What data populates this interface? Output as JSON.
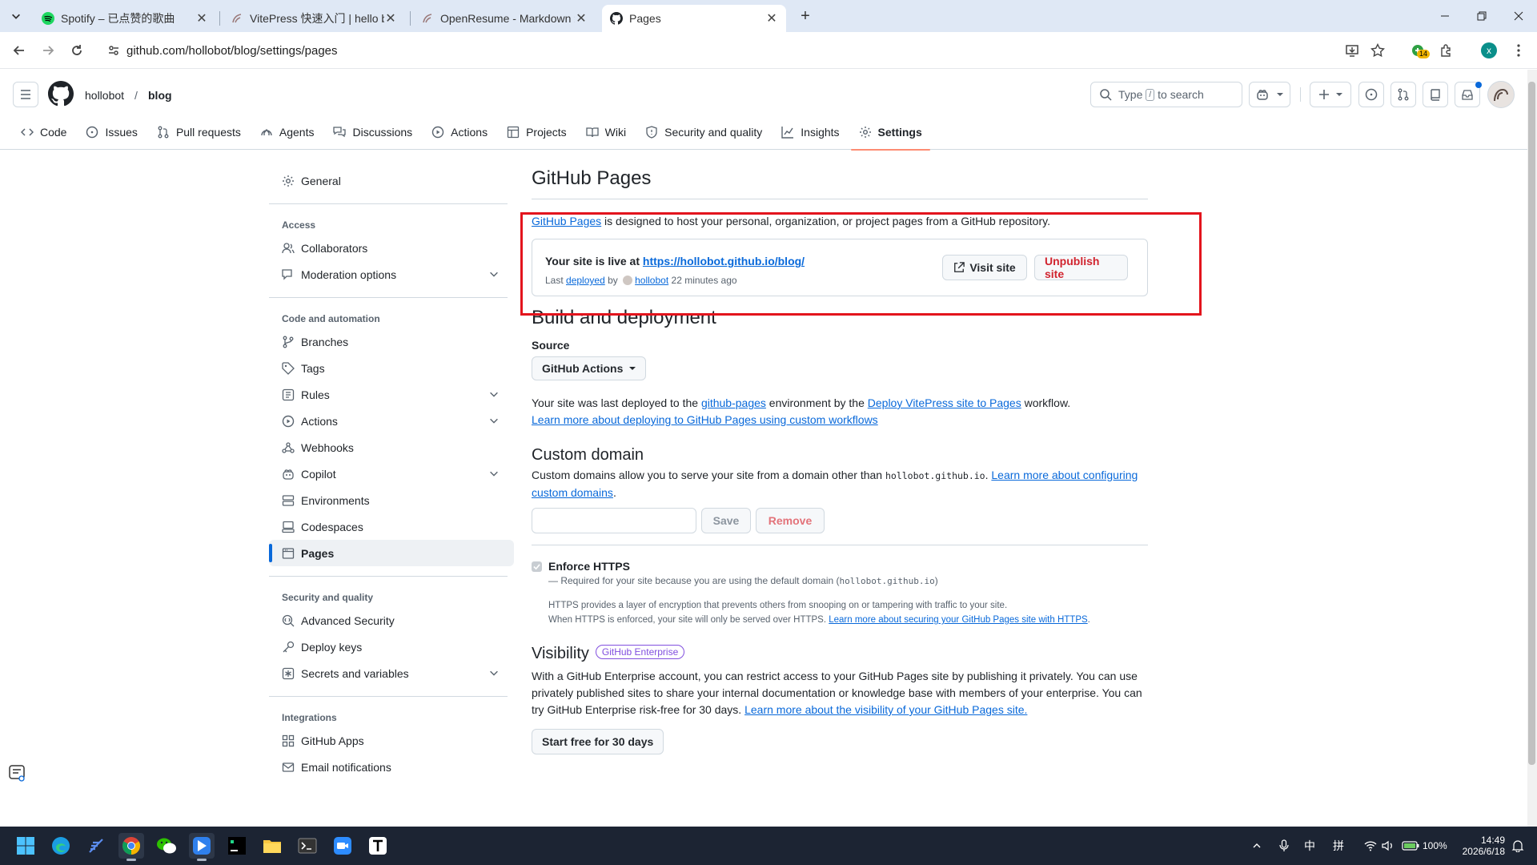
{
  "browser": {
    "tabs": [
      {
        "label": "Spotify – 已点赞的歌曲",
        "icon": "spotify-icon"
      },
      {
        "label": "VitePress 快速入门 | hello blog",
        "icon": "site-favicon"
      },
      {
        "label": "OpenResume - Markdown 编辑",
        "icon": "site-favicon"
      },
      {
        "label": "Pages",
        "icon": "github-icon"
      }
    ],
    "url": "github.com/hollobot/blog/settings/pages",
    "extension_badge": "14",
    "profile_initial": "x"
  },
  "github": {
    "owner": "hollobot",
    "separator": "/",
    "repo": "blog",
    "search_placeholder_pre": "Type",
    "search_key": "/",
    "search_placeholder_post": "to search",
    "repo_tabs": [
      "Code",
      "Issues",
      "Pull requests",
      "Agents",
      "Discussions",
      "Actions",
      "Projects",
      "Wiki",
      "Security and quality",
      "Insights",
      "Settings"
    ],
    "active_tab": "Settings"
  },
  "sidebar": {
    "general": "General",
    "access_header": "Access",
    "collaborators": "Collaborators",
    "moderation": "Moderation options",
    "code_header": "Code and automation",
    "branches": "Branches",
    "tags": "Tags",
    "rules": "Rules",
    "actions": "Actions",
    "webhooks": "Webhooks",
    "copilot": "Copilot",
    "environments": "Environments",
    "codespaces": "Codespaces",
    "pages": "Pages",
    "security_header": "Security and quality",
    "advanced_security": "Advanced Security",
    "deploy_keys": "Deploy keys",
    "secrets": "Secrets and variables",
    "integrations_header": "Integrations",
    "github_apps": "GitHub Apps",
    "email_notifications": "Email notifications"
  },
  "main": {
    "title": "GitHub Pages",
    "intro_link": "GitHub Pages",
    "intro_text": " is designed to host your personal, organization, or project pages from a GitHub repository.",
    "live_prefix": "Your site is live at ",
    "live_url": "https://hollobot.github.io/blog/",
    "last_prefix": "Last",
    "deployed_link": "deployed",
    "by": "by",
    "deployer": "hollobot",
    "time_ago": "22 minutes ago",
    "visit_site": "Visit site",
    "unpublish": "Unpublish site",
    "build_title": "Build and deployment",
    "source_label": "Source",
    "source_value": "GitHub Actions",
    "deploy_text_1": "Your site was last deployed to the ",
    "deploy_env_link": "github-pages",
    "deploy_text_2": " environment by the ",
    "deploy_workflow_link": "Deploy VitePress site to Pages",
    "deploy_text_3": " workflow.",
    "deploy_learn_link": "Learn more about deploying to GitHub Pages using custom workflows",
    "custom_domain_title": "Custom domain",
    "custom_domain_text": "Custom domains allow you to serve your site from a domain other than ",
    "custom_domain_code": "hollobot.github.io",
    "custom_domain_dot": ". ",
    "custom_domain_link": "Learn more about configuring custom domains",
    "custom_domain_end": ".",
    "domain_input_value": "",
    "save": "Save",
    "remove": "Remove",
    "https_label": "Enforce HTTPS",
    "https_required_1": "— Required for your site because you are using the default domain (",
    "https_required_code": "hollobot.github.io",
    "https_required_2": ")",
    "https_desc_1": "HTTPS provides a layer of encryption that prevents others from snooping on or tampering with traffic to your site.",
    "https_desc_2": "When HTTPS is enforced, your site will only be served over HTTPS. ",
    "https_link": "Learn more about securing your GitHub Pages site with HTTPS",
    "https_end": ".",
    "visibility_title": "Visibility",
    "enterprise_badge": "GitHub Enterprise",
    "visibility_text": "With a GitHub Enterprise account, you can restrict access to your GitHub Pages site by publishing it privately. You can use privately published sites to share your internal documentation or knowledge base with members of your enterprise. You can try GitHub Enterprise risk-free for 30 days. ",
    "visibility_link": "Learn more about the visibility of your GitHub Pages site.",
    "trial_button": "Start free for 30 days"
  },
  "taskbar": {
    "ime1": "中",
    "ime2": "拼",
    "battery": "100%",
    "time": "14:49",
    "date": "2026/6/18"
  },
  "colors": {
    "accent": "#0969da",
    "danger": "#d1242f",
    "highlight_box": "#e3141d",
    "active_tab_underline": "#fd8c73",
    "enterprise": "#8250df"
  }
}
